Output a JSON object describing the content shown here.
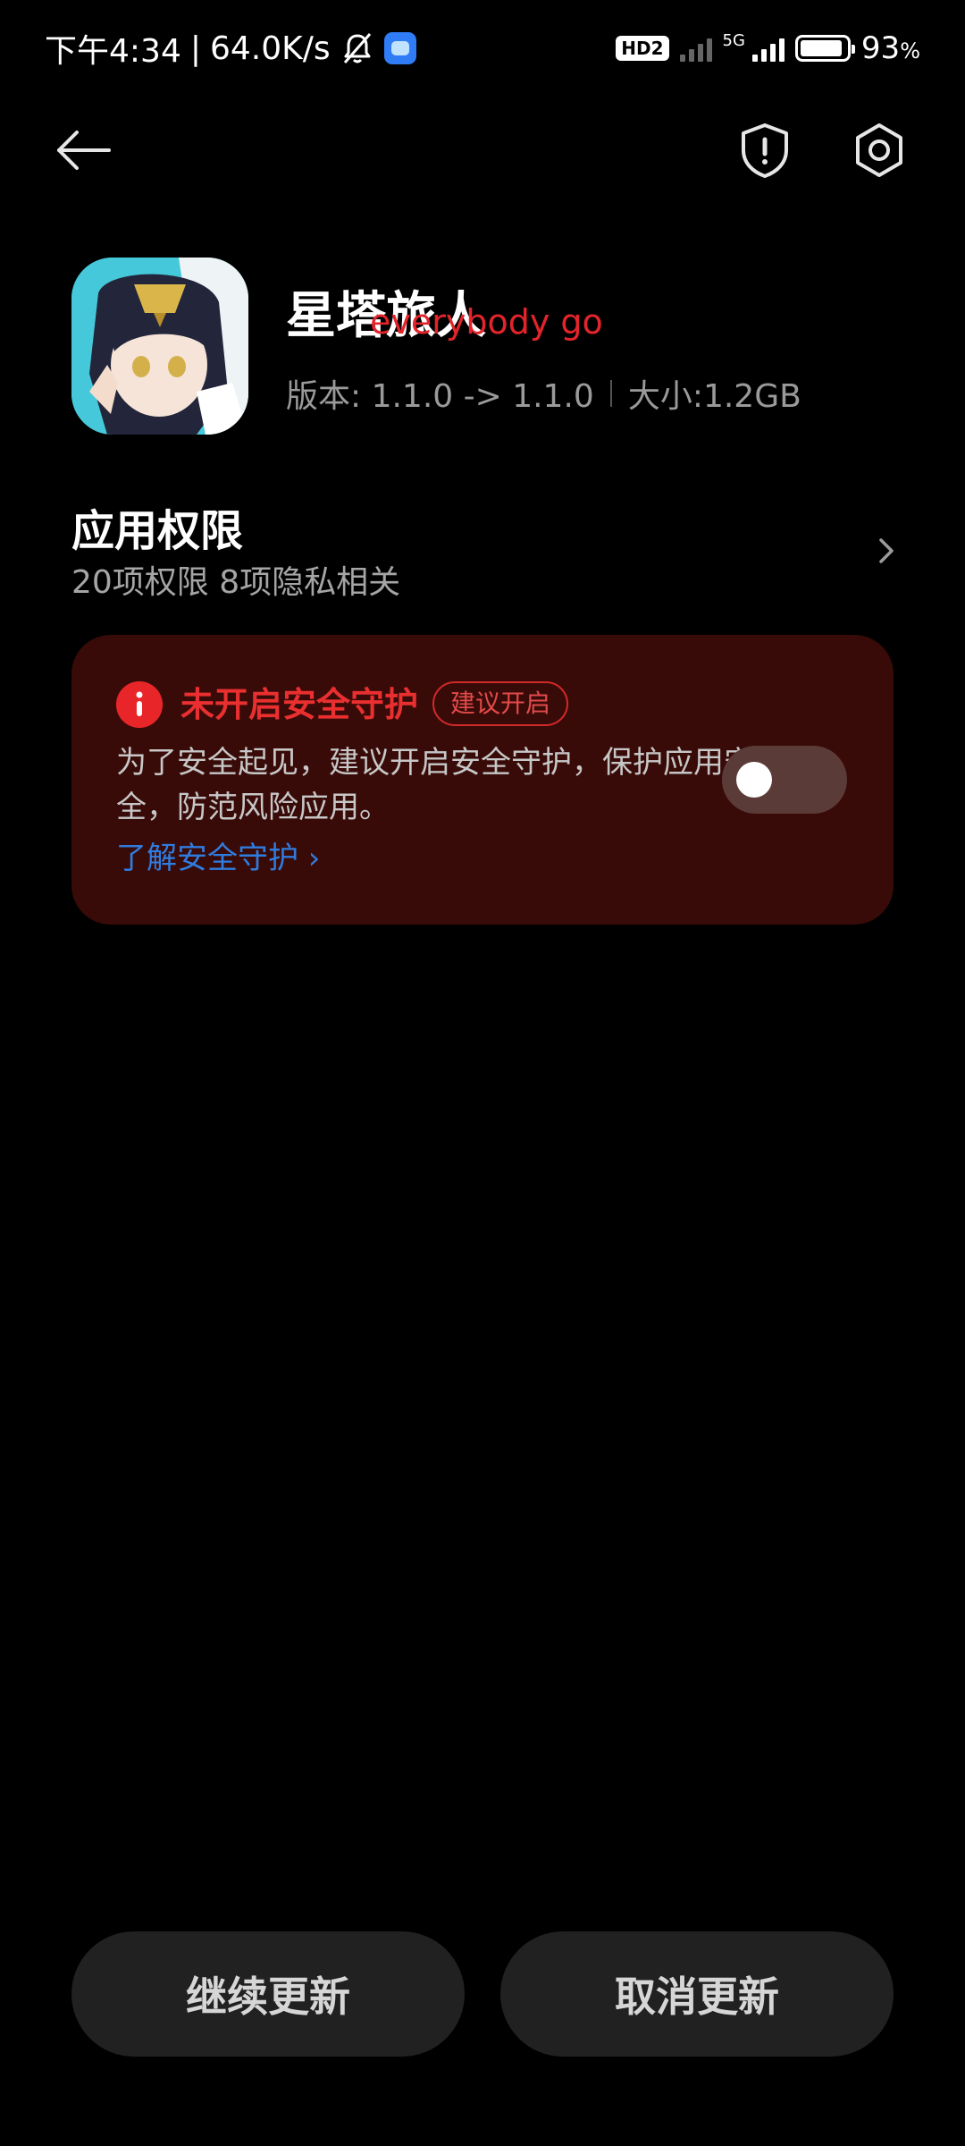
{
  "status_bar": {
    "time_text": "下午4:34",
    "separator": "|",
    "network_speed": "64.0K/s",
    "hd_label": "HD2",
    "network_type": "5G",
    "battery_percent": "93",
    "battery_percent_sign": "%",
    "battery_level": 0.93
  },
  "header": {
    "back_icon": "arrow-left-icon",
    "shield_icon": "shield-alert-icon",
    "settings_icon": "gear-icon"
  },
  "app": {
    "name": "星塔旅人",
    "overlay_text": "everybody go",
    "version_text": "版本: 1.1.0 -> 1.1.0",
    "size_text": "大小:1.2GB"
  },
  "permissions": {
    "title": "应用权限",
    "subtitle": "20项权限 8项隐私相关"
  },
  "security": {
    "title": "未开启安全守护",
    "badge": "建议开启",
    "description": "为了安全起见，建议开启安全守护，保护应用安全，防范风险应用。",
    "link": "了解安全守护 ›",
    "toggle_on": false,
    "colors": {
      "card_bg": "#390b08",
      "alert_red": "#e8262a",
      "link_blue": "#2f7ce0"
    }
  },
  "actions": {
    "continue_label": "继续更新",
    "cancel_label": "取消更新"
  }
}
